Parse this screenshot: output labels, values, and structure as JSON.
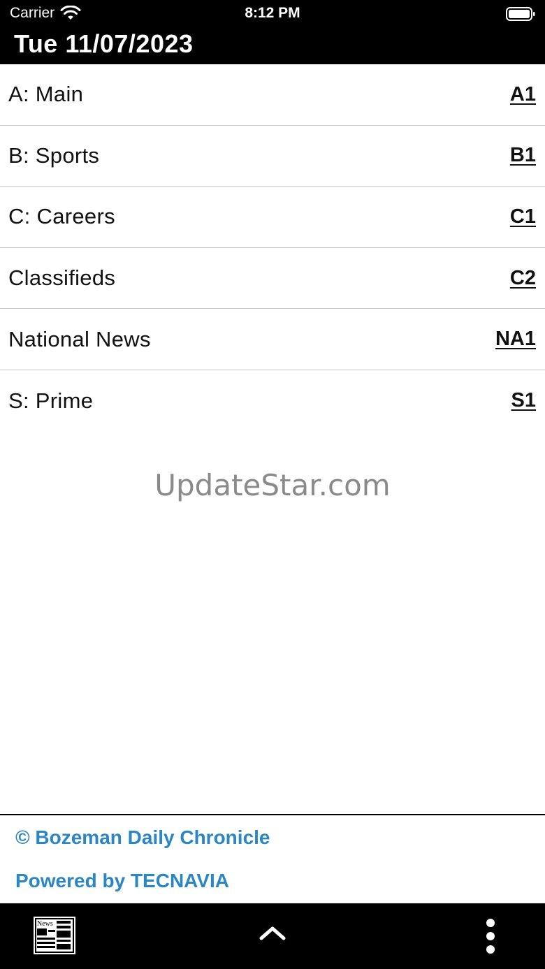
{
  "status_bar": {
    "carrier": "Carrier",
    "time": "8:12 PM"
  },
  "header": {
    "date": "Tue 11/07/2023"
  },
  "sections": [
    {
      "name": "A: Main",
      "page": "A1"
    },
    {
      "name": "B: Sports",
      "page": "B1"
    },
    {
      "name": "C: Careers",
      "page": "C1"
    },
    {
      "name": "Classifieds",
      "page": "C2"
    },
    {
      "name": "National News",
      "page": "NA1"
    },
    {
      "name": "S: Prime",
      "page": "S1"
    }
  ],
  "watermark": "UpdateStar.com",
  "footer": {
    "copyright": "© Bozeman Daily Chronicle",
    "powered_by": "Powered by TECNAVIA",
    "link_color": "#2b86c5"
  },
  "bottom_nav": {
    "news_icon_label": "News",
    "icons": [
      "newspaper-icon",
      "chevron-up-icon",
      "more-vertical-icon"
    ]
  }
}
